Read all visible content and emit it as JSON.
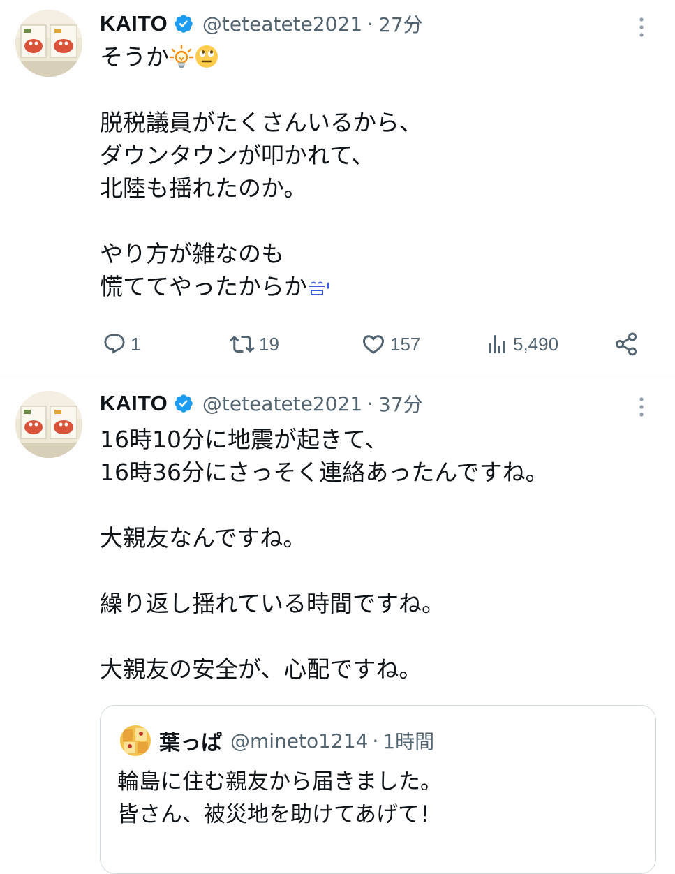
{
  "tweets": [
    {
      "author": {
        "name": "KAITO",
        "handle": "@teteatete2021",
        "verified": true
      },
      "separator": "·",
      "time": "27分",
      "lines": [
        "そうか",
        "",
        "脱税議員がたくさんいるから、",
        "ダウンタウンが叩かれて、",
        "北陸も揺れたのか。",
        "",
        "やり方が雑なのも",
        "慌ててやったからか"
      ],
      "emoji": [
        "light-bulb-emoji",
        "eye-roll-emoji",
        "sweat-emoji"
      ],
      "actions": {
        "replies": "1",
        "reposts": "19",
        "likes": "157",
        "views": "5,490"
      }
    },
    {
      "author": {
        "name": "KAITO",
        "handle": "@teteatete2021",
        "verified": true
      },
      "separator": "·",
      "time": "37分",
      "lines": [
        "16時10分に地震が起きて、",
        "16時36分にさっそく連絡あったんですね。",
        "",
        "大親友なんですね。",
        "",
        "繰り返し揺れている時間ですね。",
        "",
        "大親友の安全が、心配ですね。"
      ],
      "quote": {
        "name": "葉っぱ",
        "handle": "@mineto1214",
        "separator": "·",
        "time": "1時間",
        "lines": [
          "輪島に住む親友から届きました。",
          "皆さん、被災地を助けてあげて！"
        ]
      }
    }
  ],
  "colors": {
    "text": "#0f1419",
    "secondary": "#536471",
    "verified": "#1d9bf0",
    "divider": "#e6ecf0",
    "quote_border": "#cfd9de"
  }
}
